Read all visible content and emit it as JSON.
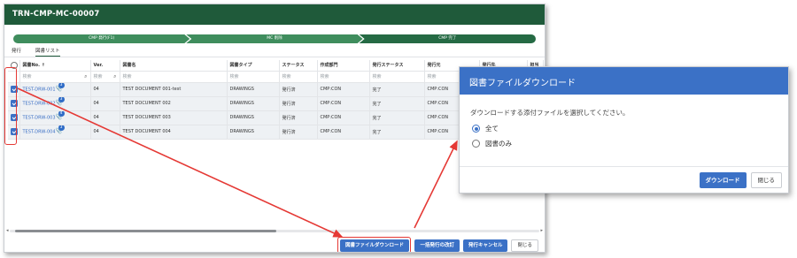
{
  "window": {
    "title": "TRN-CMP-MC-00007"
  },
  "steps": [
    "CMP 発行(F1)",
    "MC 削除",
    "CMP 完了"
  ],
  "tabs": [
    "発行",
    "図書リスト"
  ],
  "table": {
    "columns": [
      "図書No. ↑",
      "Ver.",
      "図書名",
      "図書タイプ",
      "ステータス",
      "作成部門",
      "発行ステータス",
      "発行元",
      "発行先",
      "担当"
    ],
    "filter_placeholder": "検索",
    "rows": [
      {
        "no": "TEST-DRW-001",
        "badge": "3",
        "ver": "04",
        "name": "TEST DOCUMENT 001-test",
        "type": "DRAWINGS",
        "status": "発行済",
        "dept": "CMP:CON",
        "issue_status": "完了",
        "from": "CMP:CON"
      },
      {
        "no": "TEST-DRW-002",
        "badge": "3",
        "ver": "04",
        "name": "TEST DOCUMENT 002",
        "type": "DRAWINGS",
        "status": "発行済",
        "dept": "CMP:CON",
        "issue_status": "完了",
        "from": "CMP:CON"
      },
      {
        "no": "TEST-DRW-003",
        "badge": "4",
        "ver": "04",
        "name": "TEST DOCUMENT 003",
        "type": "DRAWINGS",
        "status": "発行済",
        "dept": "CMP:CON",
        "issue_status": "完了",
        "from": "CMP:CON"
      },
      {
        "no": "TEST-DRW-004",
        "badge": "3",
        "ver": "04",
        "name": "TEST DOCUMENT 004",
        "type": "DRAWINGS",
        "status": "発行済",
        "dept": "CMP:CON",
        "issue_status": "完了",
        "from": "CMP:CON"
      }
    ]
  },
  "footer": {
    "download_button": "図書ファイルダウンロード",
    "bulk_revise_button": "一括発行の改訂",
    "cancel_issue_button": "発行キャンセル",
    "close_button": "閉じる"
  },
  "dialog": {
    "title": "図書ファイルダウンロード",
    "message": "ダウンロードする添付ファイルを選択してください。",
    "options": [
      {
        "label": "全て",
        "selected": true
      },
      {
        "label": "図書のみ",
        "selected": false
      }
    ],
    "download_button": "ダウンロード",
    "close_button": "閉じる"
  },
  "colors": {
    "header_green": "#1f5a3a",
    "accent_blue": "#3b71c6",
    "highlight_red": "#e53935"
  }
}
